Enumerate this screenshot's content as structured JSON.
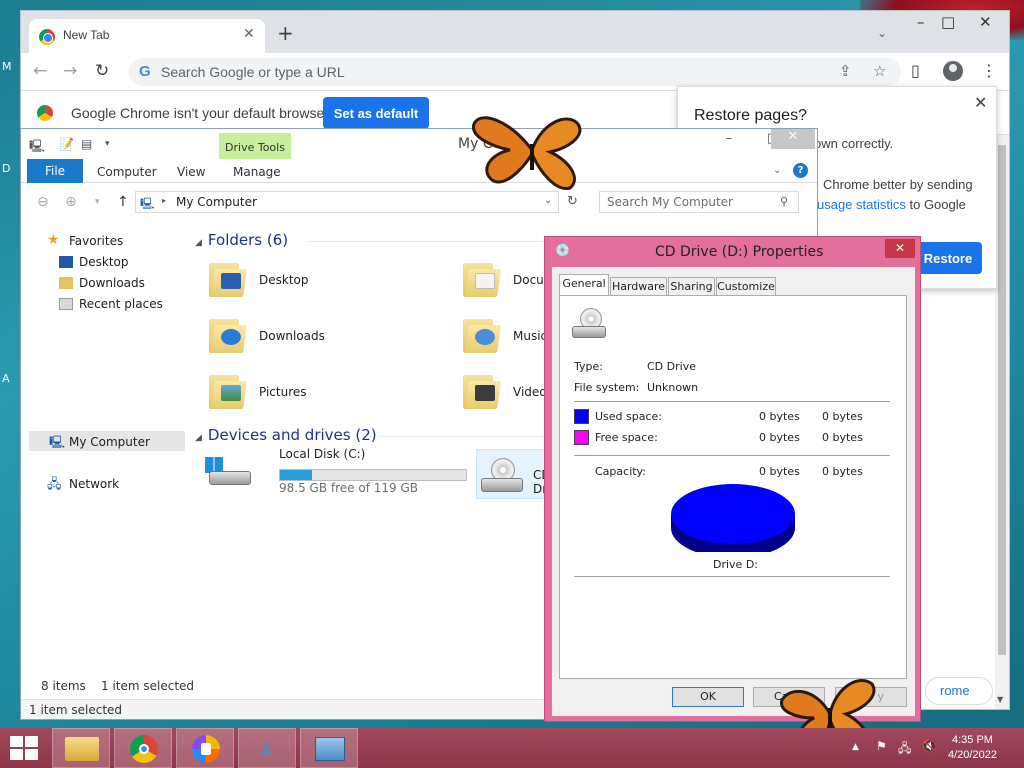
{
  "desktop": {
    "edge_letters": [
      "M",
      "D",
      "A"
    ]
  },
  "chrome": {
    "tab_title": "New Tab",
    "tab_close": "✕",
    "new_tab": "+",
    "tab_search": "⌄",
    "window_controls": [
      "–",
      "□",
      "✕"
    ],
    "omnibox_placeholder": "Search Google or type a URL",
    "infobar_text": "Google Chrome isn't your default browser",
    "set_default_label": "Set as default",
    "bottom_pill_label": "rome",
    "restore": {
      "title": "Restore pages?",
      "close": "✕",
      "line1": "own correctly.",
      "line2": "Chrome better by sending",
      "line3_link": "usage statistics",
      "line3_rest": " to Google",
      "button": "Restore"
    }
  },
  "explorer": {
    "title": "My Co",
    "drive_tools_label": "Drive Tools",
    "ribbon_tabs": [
      "File",
      "Computer",
      "View",
      "Manage"
    ],
    "address": "My Computer",
    "search_placeholder": "Search My Computer",
    "nav": {
      "favorites": "Favorites",
      "desktop": "Desktop",
      "downloads": "Downloads",
      "recent": "Recent places",
      "my_computer": "My Computer",
      "network": "Network"
    },
    "folders_header": "Folders (6)",
    "folders": [
      "Desktop",
      "Docum",
      "Downloads",
      "Music",
      "Pictures",
      "Videos"
    ],
    "devices_header": "Devices and drives (2)",
    "local_disk": {
      "name": "Local Disk (C:)",
      "free": "98.5 GB free of 119 GB",
      "used_fraction": 0.17
    },
    "cd_drive_label": "CD Dri",
    "status_items": "8 items",
    "status_selected": "1 item selected",
    "status_bar": "1 item selected"
  },
  "properties": {
    "title": "CD Drive (D:) Properties",
    "close": "✕",
    "tabs": [
      "General",
      "Hardware",
      "Sharing",
      "Customize"
    ],
    "type_label": "Type:",
    "type_value": "CD Drive",
    "fs_label": "File system:",
    "fs_value": "Unknown",
    "used_label": "Used space:",
    "free_label": "Free space:",
    "capacity_label": "Capacity:",
    "bytes_left": "0 bytes",
    "bytes_right": "0 bytes",
    "drive_caption": "Drive D:",
    "ok_label": "OK",
    "cancel_label": "Cance",
    "apply_label": "y",
    "used_color": "#0000ff",
    "free_color": "#ff00ff"
  },
  "taskbar": {
    "time": "4:35 PM",
    "date": "4/20/2022",
    "apps": [
      "file-explorer",
      "chrome",
      "avast-browser",
      "tool-app",
      "control-panel"
    ]
  }
}
